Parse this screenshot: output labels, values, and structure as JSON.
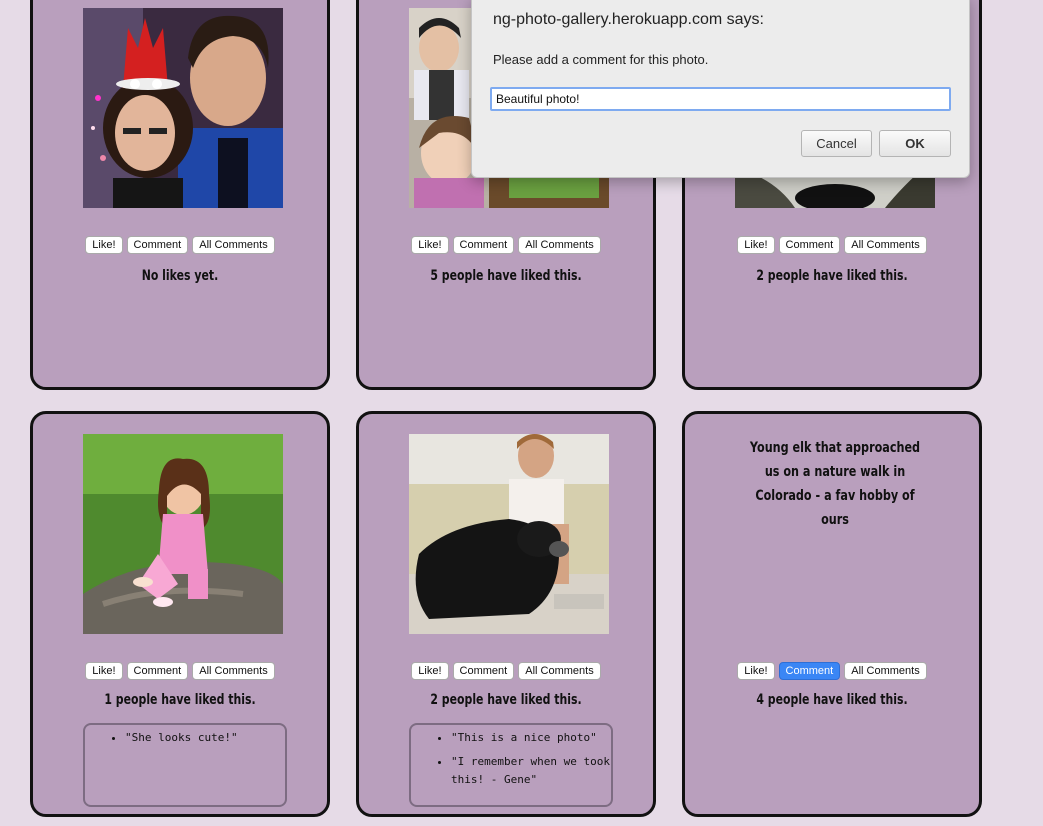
{
  "buttons": {
    "like": "Like!",
    "comment": "Comment",
    "all_comments": "All Comments"
  },
  "cards": [
    {
      "likes": "No likes yet."
    },
    {
      "likes": "5 people have liked this."
    },
    {
      "likes": "2 people have liked this."
    },
    {
      "likes": "1 people have liked this.",
      "comments": [
        "\"She looks cute!\""
      ]
    },
    {
      "likes": "2 people have liked this.",
      "comments": [
        "\"This is a nice photo\"",
        "\"I remember when we took this! - Gene\""
      ]
    },
    {
      "caption": "Young elk that approached us on a nature walk in Colorado - a fav hobby of ours",
      "likes": "4 people have liked this."
    }
  ],
  "dialog": {
    "title": "ng-photo-gallery.herokuapp.com says:",
    "message": "Please add a comment for this photo.",
    "input_value": "Beautiful photo!",
    "cancel": "Cancel",
    "ok": "OK"
  }
}
